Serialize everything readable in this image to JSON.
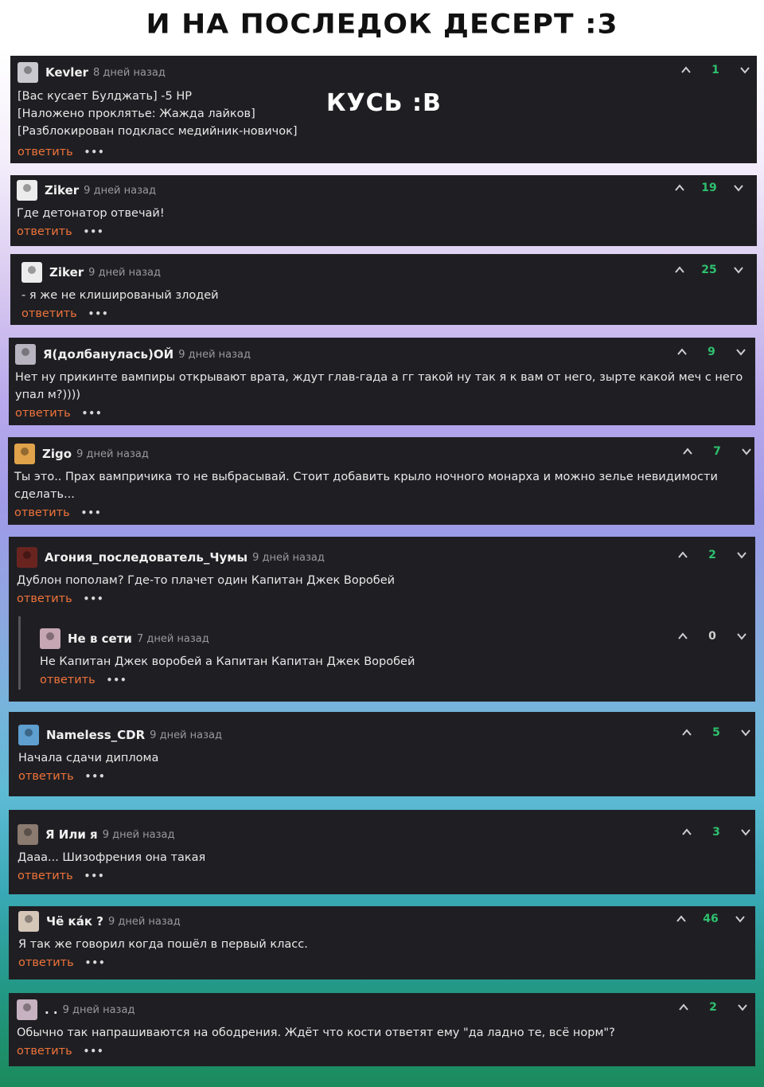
{
  "page_title": "И НА ПОСЛЕДОК ДЕСЕРТ :3",
  "sticker_text": "КУСЬ :В",
  "ui": {
    "reply_label": "ответить",
    "more_label": "•••",
    "upvote_icon": "chevron-up-icon",
    "downvote_icon": "chevron-down-icon",
    "score_color": "#2ec06e",
    "reply_color": "#f0733a"
  },
  "comments": [
    {
      "user": "Kevler",
      "time": "8 дней назад",
      "score": "1",
      "lines": [
        "[Вас кусает Булджать] -5 HP",
        "[Наложено проклятье: Жажда лайков]",
        "[Разблокирован подкласс медийник-новичок]"
      ]
    },
    {
      "user": "Ziker",
      "time": "9 дней назад",
      "score": "19",
      "lines": [
        "Где детонатор отвечай!"
      ]
    },
    {
      "user": "Ziker",
      "time": "9 дней назад",
      "score": "25",
      "lines": [
        "- я же не клишированый злодей"
      ]
    },
    {
      "user": "Я(долбанулась)ОЙ",
      "time": "9 дней назад",
      "score": "9",
      "lines": [
        "Нет ну прикинте вампиры открывают врата, ждут глав-гада а гг такой ну так я к вам от него, зырте какой меч с него",
        "упал м?))))"
      ]
    },
    {
      "user": "Zigo",
      "time": "9 дней назад",
      "score": "7",
      "lines": [
        "Ты это.. Прах вампричика то не выбрасывай. Стоит добавить крыло ночного монарха и можно зелье невидимости",
        "сделать..."
      ]
    },
    {
      "user": "Агония_последователь_Чумы",
      "time": "9 дней назад",
      "score": "2",
      "lines": [
        "Дублон пополам? Где-то плачет один Капитан Джек Воробей"
      ]
    },
    {
      "user": "Не в сети",
      "time": "7 дней назад",
      "score": "0",
      "lines": [
        "Не Капитан Джек воробей а Капитан Капитан Джек Воробей"
      ]
    },
    {
      "user": "Nameless_CDR",
      "time": "9 дней назад",
      "score": "5",
      "lines": [
        "Начала сдачи диплома"
      ]
    },
    {
      "user": "Я Или я",
      "time": "9 дней назад",
      "score": "3",
      "lines": [
        "Дааа... Шизофрения она такая"
      ]
    },
    {
      "user": "Чё ка́к ?",
      "time": "9 дней назад",
      "score": "46",
      "lines": [
        "Я так же говорил когда пошёл в первый класс."
      ]
    },
    {
      "user": ". .",
      "time": "9 дней назад",
      "score": "2",
      "lines": [
        "Обычно так напрашиваются на ободрения. Ждёт что кости ответят ему \"да ладно те, всё норм\"?"
      ]
    }
  ]
}
